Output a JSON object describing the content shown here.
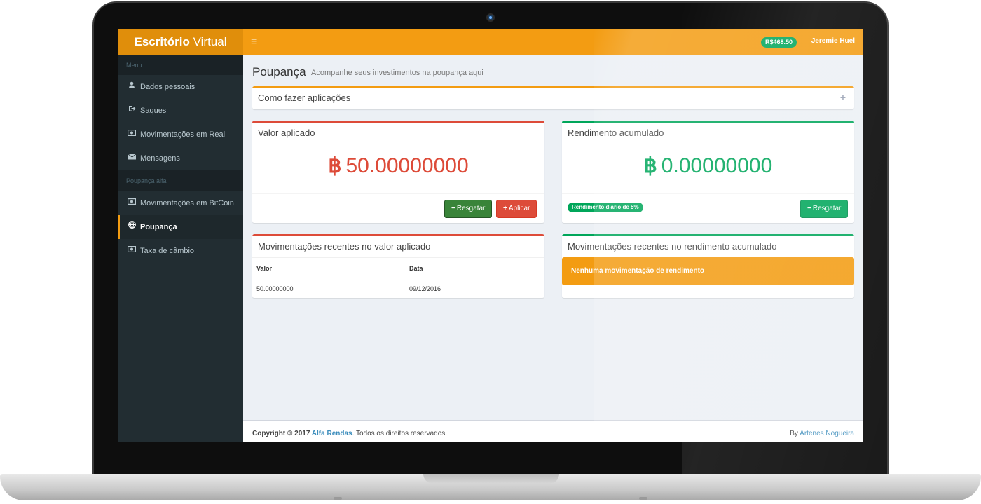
{
  "header": {
    "brand_bold": "Escritório",
    "brand_light": " Virtual",
    "menu_toggle": "≡",
    "balance": "R$468.50",
    "user": "Jeremie Huel"
  },
  "sidebar": {
    "section_menu": "Menu",
    "section_alfa": "Poupança alfa",
    "items": [
      {
        "label": "Dados pessoais",
        "icon": "user-icon"
      },
      {
        "label": "Saques",
        "icon": "sign-out-icon"
      },
      {
        "label": "Movimentações em Real",
        "icon": "money-icon"
      },
      {
        "label": "Mensagens",
        "icon": "envelope-icon"
      },
      {
        "label": "Movimentações em BitCoin",
        "icon": "money-icon"
      },
      {
        "label": "Poupança",
        "icon": "globe-icon",
        "active": true
      },
      {
        "label": "Taxa de câmbio",
        "icon": "money-icon"
      }
    ]
  },
  "page": {
    "title": "Poupança",
    "subtitle": "Acompanhe seus investimentos na poupança aqui"
  },
  "how_to": {
    "title": "Como fazer aplicações",
    "tool": "+"
  },
  "applied": {
    "title": "Valor aplicado",
    "symbol": "฿",
    "value": "50.00000000",
    "withdraw_label": "Resgatar",
    "withdraw_icon": "−",
    "apply_label": "Aplicar",
    "apply_icon": "+"
  },
  "yield": {
    "title": "Rendimento acumulado",
    "symbol": "฿",
    "value": "0.00000000",
    "rate_badge": "Rendimento diário de 5%",
    "withdraw_label": "Resgatar",
    "withdraw_icon": "−"
  },
  "recent_applied": {
    "title": "Movimentações recentes no valor aplicado",
    "columns": [
      "Valor",
      "Data"
    ],
    "rows": [
      [
        "50.00000000",
        "09/12/2016"
      ]
    ]
  },
  "recent_yield": {
    "title": "Movimentações recentes no rendimento acumulado",
    "empty_message": "Nenhuma movimentação de rendimento"
  },
  "footer": {
    "copyright_prefix": "Copyright © 2017 ",
    "company": "Alfa Rendas",
    "copyright_suffix": ". Todos os direitos reservados.",
    "by_prefix": "By ",
    "author": "Artenes Nogueira"
  },
  "colors": {
    "accent": "#f39c12",
    "success": "#00a65a",
    "danger": "#dd4b39",
    "sidebar": "#222d32"
  }
}
